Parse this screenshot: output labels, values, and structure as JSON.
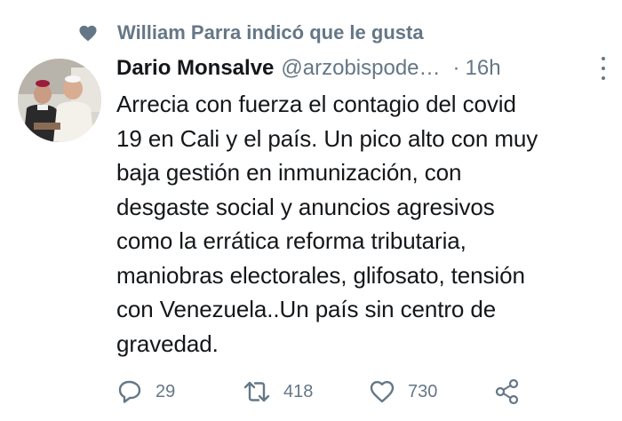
{
  "social_context": {
    "icon": "heart-icon",
    "text": "William Parra indicó que le gusta"
  },
  "tweet": {
    "author_name": "Dario Monsalve",
    "author_handle": "@arzobispode…",
    "separator": "·",
    "time": "16h",
    "text_lines": [
      "Arrecia con fuerza el contagio del covid",
      "19 en Cali y el país. Un pico alto con muy",
      "baja gestión en inmunización, con",
      "desgaste social y anuncios agresivos",
      "como la errática reforma tributaria,",
      "maniobras electorales, glifosato, tensión",
      "con Venezuela..Un país sin centro de",
      "gravedad."
    ]
  },
  "actions": {
    "reply_count": "29",
    "retweet_count": "418",
    "like_count": "730"
  },
  "colors": {
    "text": "#14171a",
    "secondary": "#657786",
    "background": "#ffffff"
  }
}
